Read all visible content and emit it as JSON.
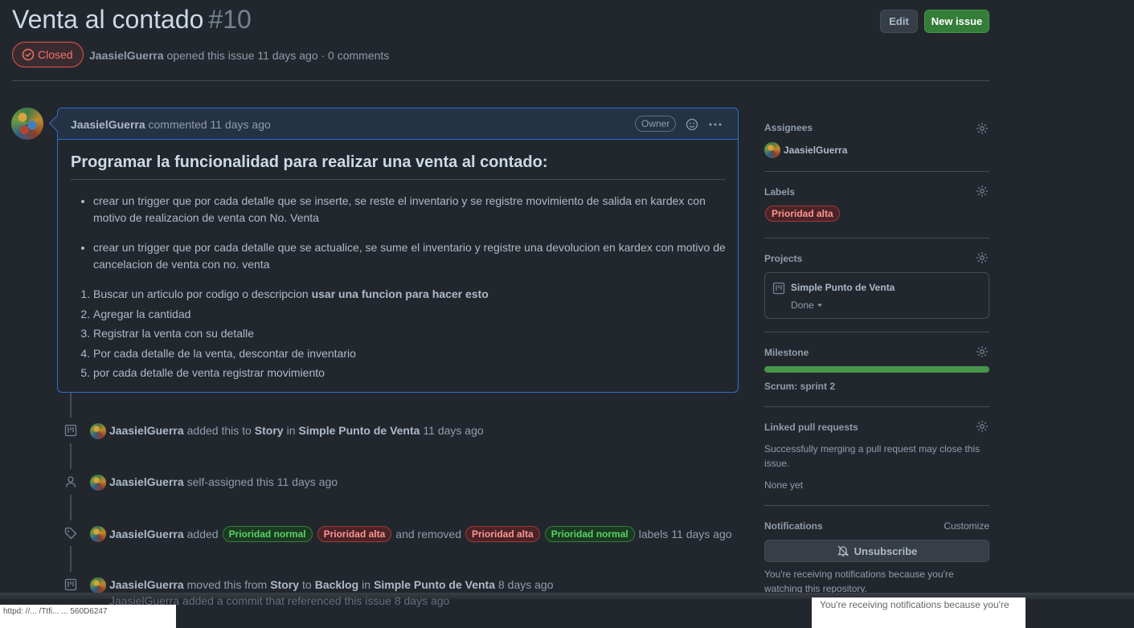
{
  "issue": {
    "title": "Venta al contado",
    "number": "#10",
    "state": "Closed",
    "author": "JaasielGuerra",
    "meta_suffix": "opened this issue 11 days ago · 0 comments"
  },
  "header_buttons": {
    "edit": "Edit",
    "new_issue": "New issue"
  },
  "comment": {
    "author": "JaasielGuerra",
    "action": "commented 11 days ago",
    "owner_badge": "Owner",
    "heading": "Programar la funcionalidad para realizar una venta al contado:",
    "bullets": [
      "crear un trigger que por cada detalle que se inserte, se reste el inventario y se registre movimiento de salida en kardex con motivo de realizacion de venta con No. Venta",
      "crear un trigger que por cada detalle que se actualice, se sume el inventario y registre una devolucion en kardex con motivo de cancelacion de venta con no. venta"
    ],
    "steps": [
      {
        "text": "Buscar un articulo por codigo o descripcion ",
        "bold": "usar una funcion para hacer esto"
      },
      {
        "text": "Agregar la cantidad",
        "bold": ""
      },
      {
        "text": "Registrar la venta con su detalle",
        "bold": ""
      },
      {
        "text": "Por cada detalle de la venta, descontar de inventario",
        "bold": ""
      },
      {
        "text": "por cada detalle de venta registrar movimiento",
        "bold": ""
      }
    ]
  },
  "timeline": {
    "e1": {
      "actor": "JaasielGuerra",
      "t1": "added this to",
      "b1": "Story",
      "t2": "in",
      "b2": "Simple Punto de Venta",
      "time": "11 days ago"
    },
    "e2": {
      "actor": "JaasielGuerra",
      "t1": "self-assigned this",
      "time": "11 days ago"
    },
    "e3": {
      "actor": "JaasielGuerra",
      "t1": "added",
      "l1": "Prioridad normal",
      "l2": "Prioridad alta",
      "t2": "and removed",
      "l3": "Prioridad alta",
      "l4": "Prioridad normal",
      "t3": "labels",
      "time": "11 days ago"
    },
    "e4": {
      "actor": "JaasielGuerra",
      "t1": "moved this from",
      "b1": "Story",
      "t2": "to",
      "b2": "Backlog",
      "t3": "in",
      "b3": "Simple Punto de Venta",
      "time": "8 days ago"
    },
    "e5_partial": "JaasielGuerra added a commit that referenced this issue 8 days ago"
  },
  "sidebar": {
    "assignees": {
      "title": "Assignees",
      "name": "JaasielGuerra"
    },
    "labels": {
      "title": "Labels",
      "label": "Prioridad alta"
    },
    "projects": {
      "title": "Projects",
      "project": "Simple Punto de Venta",
      "status": "Done"
    },
    "milestone": {
      "title": "Milestone",
      "name": "Scrum: sprint 2",
      "progress": 1.0
    },
    "linked_prs": {
      "title": "Linked pull requests",
      "desc": "Successfully merging a pull request may close this issue.",
      "none": "None yet"
    },
    "notifications": {
      "title": "Notifications",
      "customize": "Customize",
      "button": "Unsubscribe",
      "desc": "You're receiving notifications because you're watching this repository."
    }
  },
  "artifacts": {
    "left_text": "httpd: //... /Ttfi... ... 560D6247",
    "right_text": "You're receiving notifications because you're"
  },
  "colors": {
    "accent": "#316dca",
    "closed": "#e5534b",
    "success": "#347d39",
    "bg": "#22272e"
  }
}
